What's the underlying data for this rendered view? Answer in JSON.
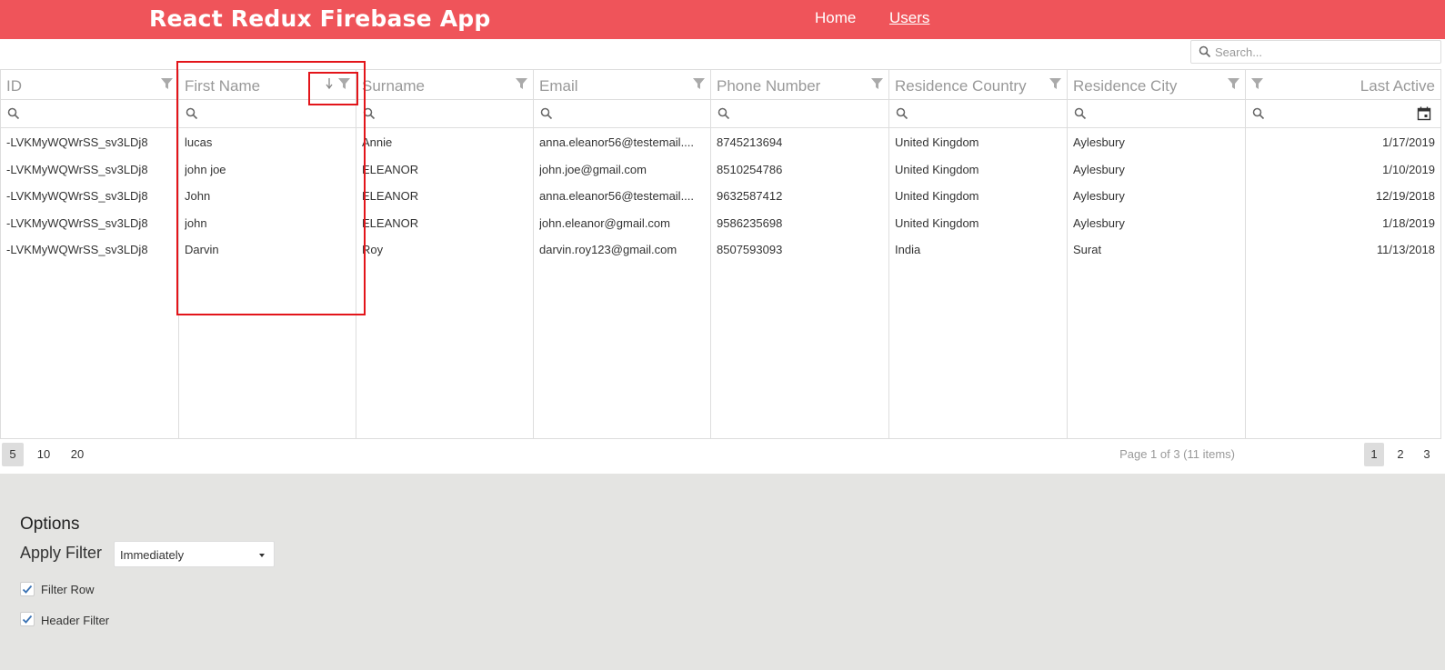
{
  "navbar": {
    "brand": "React Redux Firebase App",
    "links": [
      {
        "label": "Home"
      },
      {
        "label": "Users"
      }
    ]
  },
  "search": {
    "placeholder": "Search..."
  },
  "grid": {
    "columns": [
      {
        "label": "ID"
      },
      {
        "label": "First Name"
      },
      {
        "label": "Surname"
      },
      {
        "label": "Email"
      },
      {
        "label": "Phone Number"
      },
      {
        "label": "Residence Country"
      },
      {
        "label": "Residence City"
      },
      {
        "label": "Last Active"
      }
    ],
    "rows": [
      [
        "-LVKMyWQWrSS_sv3LDj8",
        "lucas",
        "Annie",
        "anna.eleanor56@testemail....",
        "8745213694",
        "United Kingdom",
        "Aylesbury",
        "1/17/2019"
      ],
      [
        "-LVKMyWQWrSS_sv3LDj8",
        "john joe",
        "ELEANOR",
        "john.joe@gmail.com",
        "8510254786",
        "United Kingdom",
        "Aylesbury",
        "1/10/2019"
      ],
      [
        "-LVKMyWQWrSS_sv3LDj8",
        "John",
        "ELEANOR",
        "anna.eleanor56@testemail....",
        "9632587412",
        "United Kingdom",
        "Aylesbury",
        "12/19/2018"
      ],
      [
        "-LVKMyWQWrSS_sv3LDj8",
        "john",
        "ELEANOR",
        "john.eleanor@gmail.com",
        "9586235698",
        "United Kingdom",
        "Aylesbury",
        "1/18/2019"
      ],
      [
        "-LVKMyWQWrSS_sv3LDj8",
        "Darvin",
        "Roy",
        "darvin.roy123@gmail.com",
        "8507593093",
        "India",
        "Surat",
        "11/13/2018"
      ]
    ]
  },
  "pager": {
    "sizes": [
      "5",
      "10",
      "20"
    ],
    "info": "Page 1 of 3 (11 items)",
    "pages": [
      "1",
      "2",
      "3"
    ]
  },
  "options": {
    "title": "Options",
    "apply_filter_label": "Apply Filter",
    "apply_filter_value": "Immediately",
    "checkboxes": [
      {
        "label": "Filter Row"
      },
      {
        "label": "Header Filter"
      }
    ]
  },
  "colors": {
    "navbar": "#ef545a",
    "annotation": "#e3151a",
    "options_bg": "#e4e4e2"
  }
}
